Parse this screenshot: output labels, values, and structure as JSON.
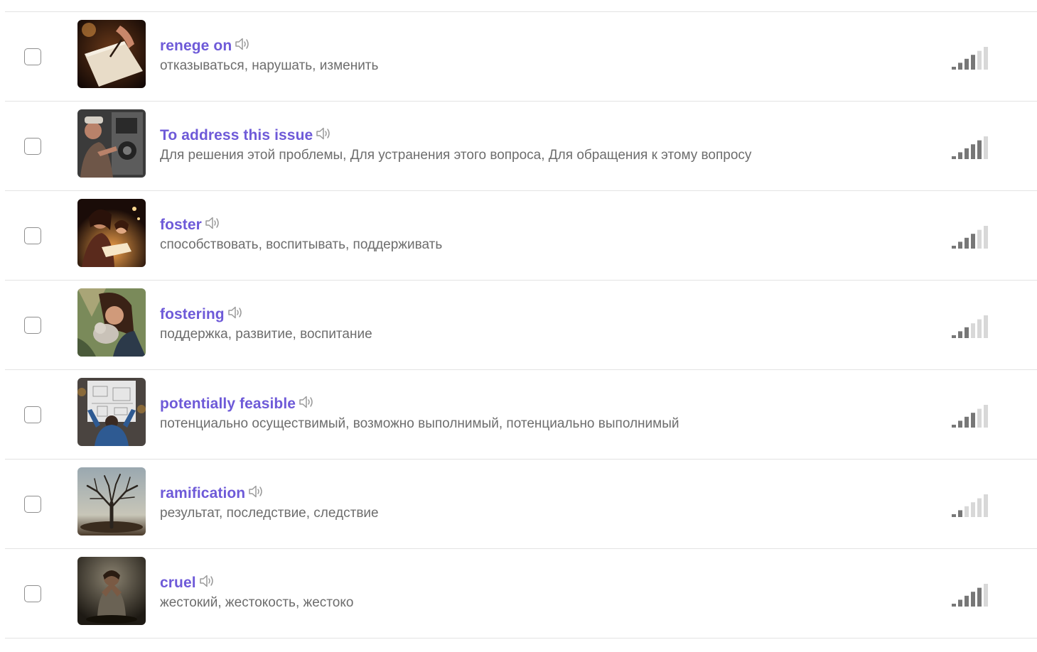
{
  "colors": {
    "word": "#6e5ad8",
    "translation": "#6d6d6d",
    "level_filled": "#777777",
    "level_empty": "#d8d8d8",
    "divider": "#e3e3e3"
  },
  "icons": {
    "speaker": "speaker-icon",
    "level": "signal-bars-icon"
  },
  "words": [
    {
      "word": "renege on",
      "translation": "отказываться, нарушать, изменить",
      "level": 4,
      "level_max": 6,
      "image": "hand-writing-paper"
    },
    {
      "word": "To address this issue",
      "translation": "Для решения этой проблемы, Для устранения этого вопроса, Для обращения к этому вопросу",
      "level": 5,
      "level_max": 6,
      "image": "mechanic-with-machine"
    },
    {
      "word": "foster",
      "translation": "способствовать, воспитывать, поддерживать",
      "level": 4,
      "level_max": 6,
      "image": "mother-reading-to-child"
    },
    {
      "word": "fostering",
      "translation": "поддержка, развитие, воспитание",
      "level": 3,
      "level_max": 6,
      "image": "woman-hugging-cat"
    },
    {
      "word": "potentially feasible",
      "translation": "потенциально осуществимый, возможно выполнимый, потенциально выполнимый",
      "level": 4,
      "level_max": 6,
      "image": "person-with-blueprint"
    },
    {
      "word": "ramification",
      "translation": "результат, последствие, следствие",
      "level": 2,
      "level_max": 6,
      "image": "bare-tree"
    },
    {
      "word": "cruel",
      "translation": "жестокий, жестокость, жестоко",
      "level": 5,
      "level_max": 6,
      "image": "sad-seated-figure"
    }
  ]
}
